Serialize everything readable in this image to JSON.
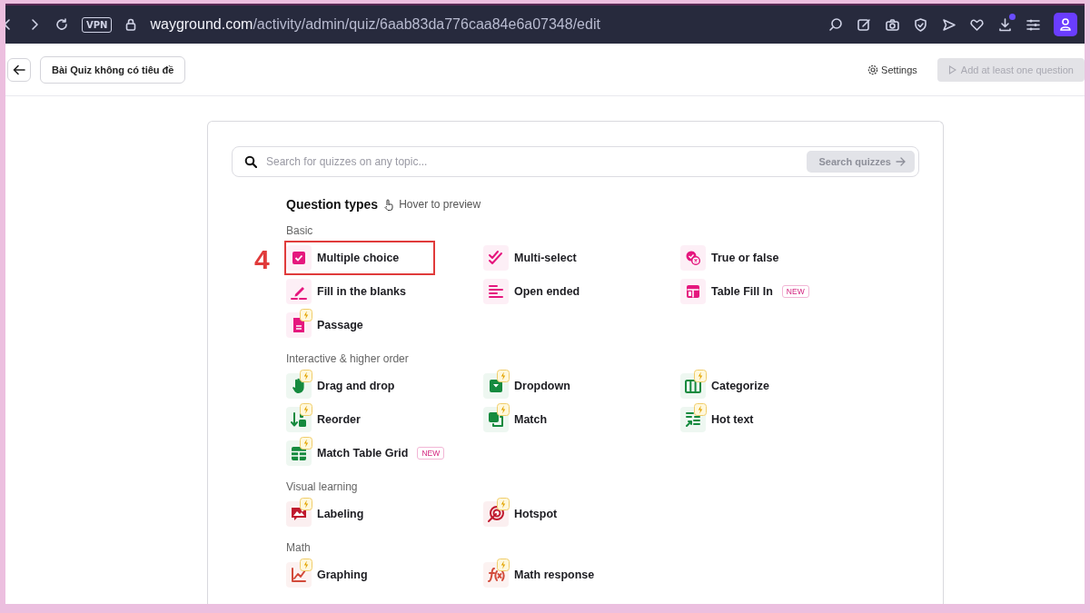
{
  "browser": {
    "address_host": "wayground.com",
    "address_path": "/activity/admin/quiz/6aab83da776caa84e6a07348/edit",
    "vpn_label": "VPN",
    "download_badge": true
  },
  "header": {
    "quiz_title": "Bài Quiz không có tiêu đề",
    "settings_label": "Settings",
    "add_button": {
      "label": "Add at least one question",
      "disabled": true
    }
  },
  "search": {
    "placeholder": "Search for quizzes on any topic...",
    "button": {
      "label": "Search quizzes",
      "disabled": true
    }
  },
  "question_types": {
    "title": "Question types",
    "hint": "Hover to preview"
  },
  "annotation": {
    "label": "4"
  },
  "sections": [
    {
      "title": "Basic",
      "color": "#e5177e",
      "items": [
        {
          "label": "Multiple choice",
          "premium": false,
          "highlighted": true
        },
        {
          "label": "Multi-select",
          "premium": false,
          "highlighted": false
        },
        {
          "label": "True or false",
          "premium": false,
          "highlighted": false
        },
        {
          "label": "Fill in the blanks",
          "premium": false,
          "highlighted": false
        },
        {
          "label": "Open ended",
          "premium": false,
          "highlighted": false
        },
        {
          "label": "Table Fill In",
          "badge": "NEW",
          "premium": false,
          "highlighted": false
        },
        {
          "label": "Passage",
          "premium": true,
          "highlighted": false
        }
      ]
    },
    {
      "title": "Interactive & higher order",
      "color": "#158a3e",
      "items": [
        {
          "label": "Drag and drop",
          "premium": true,
          "highlighted": false
        },
        {
          "label": "Dropdown",
          "premium": true,
          "highlighted": false
        },
        {
          "label": "Categorize",
          "premium": true,
          "highlighted": false
        },
        {
          "label": "Reorder",
          "premium": true,
          "highlighted": false
        },
        {
          "label": "Match",
          "premium": true,
          "highlighted": false
        },
        {
          "label": "Hot text",
          "premium": true,
          "highlighted": false
        },
        {
          "label": "Match Table Grid",
          "badge": "NEW",
          "premium": true,
          "highlighted": false
        }
      ]
    },
    {
      "title": "Visual learning",
      "color": "#c0192e",
      "items": [
        {
          "label": "Labeling",
          "premium": true,
          "highlighted": false
        },
        {
          "label": "Hotspot",
          "premium": true,
          "highlighted": false
        }
      ]
    },
    {
      "title": "Math",
      "color": "#d24a3a",
      "items": [
        {
          "label": "Graphing",
          "premium": true,
          "highlighted": false
        },
        {
          "label": "Math response",
          "premium": true,
          "highlighted": false
        }
      ]
    }
  ]
}
